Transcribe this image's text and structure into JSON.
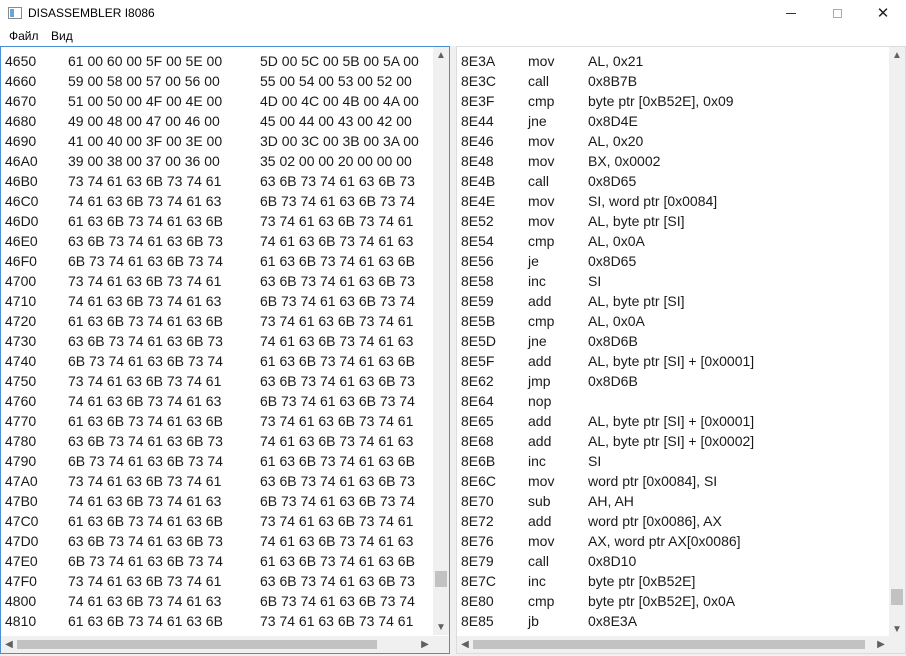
{
  "window": {
    "title": "DISASSEMBLER I8086",
    "icons": {
      "app": "app-window-icon",
      "minimize": "minimize-icon",
      "maximize": "maximize-icon",
      "close": "close-icon"
    },
    "close_glyph": "✕"
  },
  "menu": {
    "file": "Файл",
    "view": "Вид"
  },
  "scroll_glyphs": {
    "up": "▲",
    "down": "▼",
    "left": "◀",
    "right": "▶"
  },
  "hex_rows": [
    {
      "addr": "4650",
      "b1": "61 00 60 00 5F 00 5E 00",
      "b2": "5D 00 5C 00 5B 00 5A 00"
    },
    {
      "addr": "4660",
      "b1": "59 00 58 00 57 00 56 00",
      "b2": "55 00 54 00 53 00 52 00"
    },
    {
      "addr": "4670",
      "b1": "51 00 50 00 4F 00 4E 00",
      "b2": "4D 00 4C 00 4B 00 4A 00"
    },
    {
      "addr": "4680",
      "b1": "49 00 48 00 47 00 46 00",
      "b2": "45 00 44 00 43 00 42 00"
    },
    {
      "addr": "4690",
      "b1": "41 00 40 00 3F 00 3E 00",
      "b2": "3D 00 3C 00 3B 00 3A 00"
    },
    {
      "addr": "46A0",
      "b1": "39 00 38 00 37 00 36 00",
      "b2": "35 02 00 00 20 00 00 00"
    },
    {
      "addr": "46B0",
      "b1": "73 74 61 63 6B 73 74 61",
      "b2": "63 6B 73 74 61 63 6B 73"
    },
    {
      "addr": "46C0",
      "b1": "74 61 63 6B 73 74 61 63",
      "b2": "6B 73 74 61 63 6B 73 74"
    },
    {
      "addr": "46D0",
      "b1": "61 63 6B 73 74 61 63 6B",
      "b2": "73 74 61 63 6B 73 74 61"
    },
    {
      "addr": "46E0",
      "b1": "63 6B 73 74 61 63 6B 73",
      "b2": "74 61 63 6B 73 74 61 63"
    },
    {
      "addr": "46F0",
      "b1": "6B 73 74 61 63 6B 73 74",
      "b2": "61 63 6B 73 74 61 63 6B"
    },
    {
      "addr": "4700",
      "b1": "73 74 61 63 6B 73 74 61",
      "b2": "63 6B 73 74 61 63 6B 73"
    },
    {
      "addr": "4710",
      "b1": "74 61 63 6B 73 74 61 63",
      "b2": "6B 73 74 61 63 6B 73 74"
    },
    {
      "addr": "4720",
      "b1": "61 63 6B 73 74 61 63 6B",
      "b2": "73 74 61 63 6B 73 74 61"
    },
    {
      "addr": "4730",
      "b1": "63 6B 73 74 61 63 6B 73",
      "b2": "74 61 63 6B 73 74 61 63"
    },
    {
      "addr": "4740",
      "b1": "6B 73 74 61 63 6B 73 74",
      "b2": "61 63 6B 73 74 61 63 6B"
    },
    {
      "addr": "4750",
      "b1": "73 74 61 63 6B 73 74 61",
      "b2": "63 6B 73 74 61 63 6B 73"
    },
    {
      "addr": "4760",
      "b1": "74 61 63 6B 73 74 61 63",
      "b2": "6B 73 74 61 63 6B 73 74"
    },
    {
      "addr": "4770",
      "b1": "61 63 6B 73 74 61 63 6B",
      "b2": "73 74 61 63 6B 73 74 61"
    },
    {
      "addr": "4780",
      "b1": "63 6B 73 74 61 63 6B 73",
      "b2": "74 61 63 6B 73 74 61 63"
    },
    {
      "addr": "4790",
      "b1": "6B 73 74 61 63 6B 73 74",
      "b2": "61 63 6B 73 74 61 63 6B"
    },
    {
      "addr": "47A0",
      "b1": "73 74 61 63 6B 73 74 61",
      "b2": "63 6B 73 74 61 63 6B 73"
    },
    {
      "addr": "47B0",
      "b1": "74 61 63 6B 73 74 61 63",
      "b2": "6B 73 74 61 63 6B 73 74"
    },
    {
      "addr": "47C0",
      "b1": "61 63 6B 73 74 61 63 6B",
      "b2": "73 74 61 63 6B 73 74 61"
    },
    {
      "addr": "47D0",
      "b1": "63 6B 73 74 61 63 6B 73",
      "b2": "74 61 63 6B 73 74 61 63"
    },
    {
      "addr": "47E0",
      "b1": "6B 73 74 61 63 6B 73 74",
      "b2": "61 63 6B 73 74 61 63 6B"
    },
    {
      "addr": "47F0",
      "b1": "73 74 61 63 6B 73 74 61",
      "b2": "63 6B 73 74 61 63 6B 73"
    },
    {
      "addr": "4800",
      "b1": "74 61 63 6B 73 74 61 63",
      "b2": "6B 73 74 61 63 6B 73 74"
    },
    {
      "addr": "4810",
      "b1": "61 63 6B 73 74 61 63 6B",
      "b2": "73 74 61 63 6B 73 74 61"
    }
  ],
  "asm_rows": [
    {
      "addr": "8E3A",
      "op": "mov",
      "args": "AL, 0x21"
    },
    {
      "addr": "8E3C",
      "op": "call",
      "args": "0x8B7B"
    },
    {
      "addr": "8E3F",
      "op": "cmp",
      "args": "byte ptr [0xB52E], 0x09"
    },
    {
      "addr": "8E44",
      "op": "jne",
      "args": "0x8D4E"
    },
    {
      "addr": "8E46",
      "op": "mov",
      "args": "AL, 0x20"
    },
    {
      "addr": "8E48",
      "op": "mov",
      "args": "BX, 0x0002"
    },
    {
      "addr": "8E4B",
      "op": "call",
      "args": "0x8D65"
    },
    {
      "addr": "8E4E",
      "op": "mov",
      "args": "SI, word ptr [0x0084]"
    },
    {
      "addr": "8E52",
      "op": "mov",
      "args": "AL, byte ptr [SI]"
    },
    {
      "addr": "8E54",
      "op": "cmp",
      "args": "AL, 0x0A"
    },
    {
      "addr": "8E56",
      "op": "je",
      "args": "0x8D65"
    },
    {
      "addr": "8E58",
      "op": "inc",
      "args": "SI"
    },
    {
      "addr": "8E59",
      "op": "add",
      "args": "AL, byte ptr [SI]"
    },
    {
      "addr": "8E5B",
      "op": "cmp",
      "args": "AL, 0x0A"
    },
    {
      "addr": "8E5D",
      "op": "jne",
      "args": "0x8D6B"
    },
    {
      "addr": "8E5F",
      "op": "add",
      "args": "AL, byte ptr [SI] + [0x0001]"
    },
    {
      "addr": "8E62",
      "op": "jmp",
      "args": "0x8D6B"
    },
    {
      "addr": "8E64",
      "op": "nop",
      "args": ""
    },
    {
      "addr": "8E65",
      "op": "add",
      "args": "AL, byte ptr [SI] + [0x0001]"
    },
    {
      "addr": "8E68",
      "op": "add",
      "args": "AL, byte ptr [SI] + [0x0002]"
    },
    {
      "addr": "8E6B",
      "op": "inc",
      "args": "SI"
    },
    {
      "addr": "8E6C",
      "op": "mov",
      "args": "word ptr [0x0084], SI"
    },
    {
      "addr": "8E70",
      "op": "sub",
      "args": "AH, AH"
    },
    {
      "addr": "8E72",
      "op": "add",
      "args": "word ptr [0x0086], AX"
    },
    {
      "addr": "8E76",
      "op": "mov",
      "args": "AX, word ptr AX[0x0086]"
    },
    {
      "addr": "8E79",
      "op": "call",
      "args": "0x8D10"
    },
    {
      "addr": "8E7C",
      "op": "inc",
      "args": "byte ptr [0xB52E]"
    },
    {
      "addr": "8E80",
      "op": "cmp",
      "args": "byte ptr [0xB52E], 0x0A"
    },
    {
      "addr": "8E85",
      "op": "jb",
      "args": "0x8E3A"
    }
  ],
  "scroll": {
    "left_vertical_position": 0.94,
    "right_vertical_position": 0.97,
    "left_horizontal_position": 0.0,
    "left_horizontal_visible_fraction": 0.9,
    "right_horizontal_position": 0.0,
    "right_horizontal_visible_fraction": 0.98
  }
}
